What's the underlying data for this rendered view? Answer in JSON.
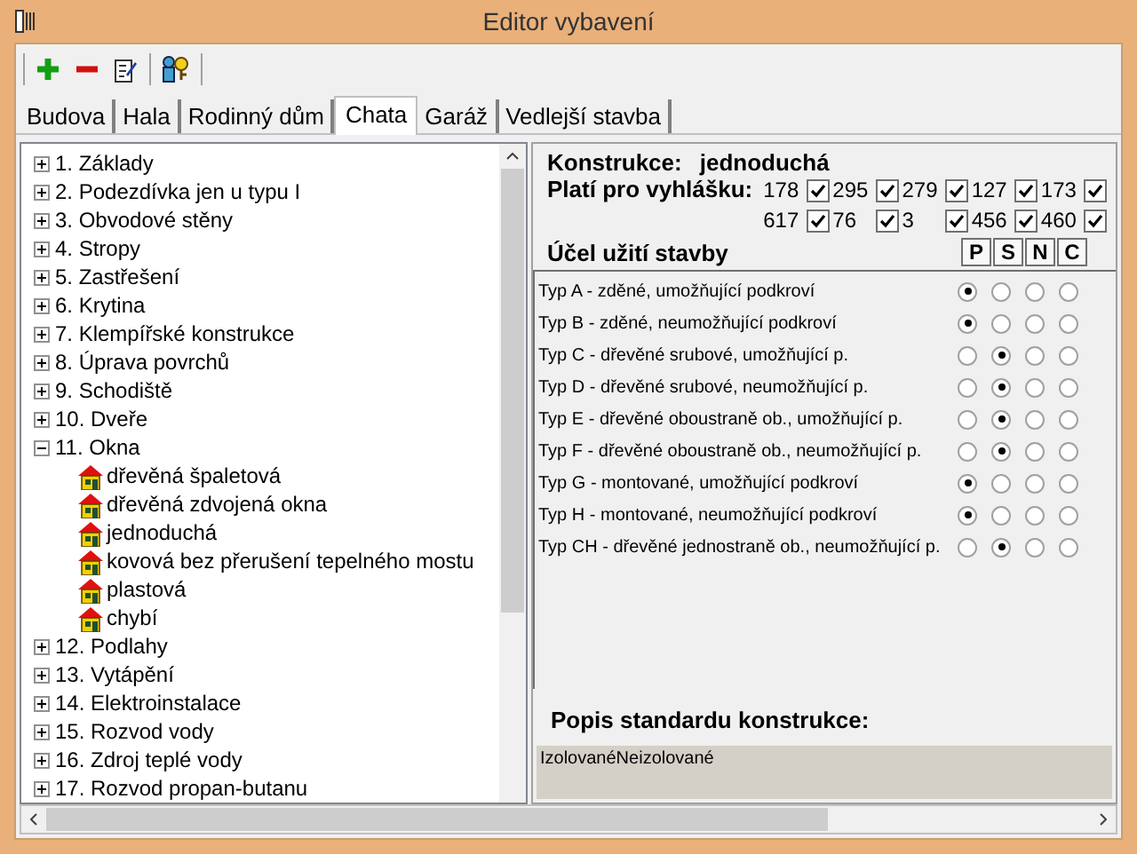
{
  "window": {
    "title": "Editor vybavení"
  },
  "tabs": [
    {
      "label": "Budova",
      "selected": false
    },
    {
      "label": "Hala",
      "selected": false
    },
    {
      "label": "Rodinný dům",
      "selected": false
    },
    {
      "label": "Chata",
      "selected": true
    },
    {
      "label": "Garáž",
      "selected": false
    },
    {
      "label": "Vedlejší stavba",
      "selected": false
    }
  ],
  "tree": [
    {
      "label": "1. Základy",
      "expanded": false
    },
    {
      "label": "2. Podezdívka jen u typu I",
      "expanded": false
    },
    {
      "label": "3. Obvodové stěny",
      "expanded": false
    },
    {
      "label": "4. Stropy",
      "expanded": false
    },
    {
      "label": "5. Zastřešení",
      "expanded": false
    },
    {
      "label": "6. Krytina",
      "expanded": false
    },
    {
      "label": "7. Klempířské konstrukce",
      "expanded": false
    },
    {
      "label": "8. Úprava povrchů",
      "expanded": false
    },
    {
      "label": "9. Schodiště",
      "expanded": false
    },
    {
      "label": "10. Dveře",
      "expanded": false
    },
    {
      "label": "11. Okna",
      "expanded": true,
      "children": [
        {
          "label": "dřevěná špaletová"
        },
        {
          "label": "dřevěná zdvojená okna"
        },
        {
          "label": "jednoduchá"
        },
        {
          "label": "kovová bez přerušení tepelného mostu"
        },
        {
          "label": "plastová"
        },
        {
          "label": "chybí"
        }
      ]
    },
    {
      "label": "12. Podlahy",
      "expanded": false
    },
    {
      "label": "13. Vytápění",
      "expanded": false
    },
    {
      "label": "14. Elektroinstalace",
      "expanded": false
    },
    {
      "label": "15. Rozvod vody",
      "expanded": false
    },
    {
      "label": "16. Zdroj teplé vody",
      "expanded": false
    },
    {
      "label": "17. Rozvod propan-butanu",
      "expanded": false
    }
  ],
  "konstrukce": {
    "label": "Konstrukce:",
    "value": "jednoduchá"
  },
  "vyhlasky": {
    "label": "Platí pro vyhlášku:",
    "items": [
      {
        "number": "178",
        "checked": true
      },
      {
        "number": "295",
        "checked": true
      },
      {
        "number": "279",
        "checked": true
      },
      {
        "number": "127",
        "checked": true
      },
      {
        "number": "173",
        "checked": true
      },
      {
        "number": "617",
        "checked": true
      },
      {
        "number": "76",
        "checked": true
      },
      {
        "number": "3",
        "checked": true
      },
      {
        "number": "456",
        "checked": true
      },
      {
        "number": "460",
        "checked": true
      }
    ]
  },
  "ucel": {
    "title": "Účel užití stavby",
    "columns": [
      "P",
      "S",
      "N",
      "C"
    ],
    "rows": [
      {
        "label": "Typ A - zděné, umožňující podkroví",
        "options": [
          true,
          false,
          false,
          false
        ]
      },
      {
        "label": "Typ B - zděné, neumožňující podkroví",
        "options": [
          true,
          false,
          false,
          false
        ]
      },
      {
        "label": "Typ C - dřevěné srubové, umožňující p.",
        "options": [
          false,
          true,
          false,
          false
        ]
      },
      {
        "label": "Typ D - dřevěné srubové, neumožňující p.",
        "options": [
          false,
          true,
          false,
          false
        ]
      },
      {
        "label": "Typ E - dřevěné oboustraně ob., umožňující p.",
        "options": [
          false,
          true,
          false,
          false
        ]
      },
      {
        "label": "Typ F - dřevěné oboustraně ob., neumožňující p.",
        "options": [
          false,
          true,
          false,
          false
        ]
      },
      {
        "label": "Typ G - montované, umožňující podkroví",
        "options": [
          true,
          false,
          false,
          false
        ]
      },
      {
        "label": "Typ H - montované, neumožňující podkroví",
        "options": [
          true,
          false,
          false,
          false
        ]
      },
      {
        "label": "Typ CH - dřevěné jednostraně ob., neumožňující p.",
        "options": [
          false,
          true,
          false,
          false
        ]
      }
    ]
  },
  "popis": {
    "title": "Popis standardu konstrukce:",
    "value": "IzolovanéNeizolované"
  }
}
